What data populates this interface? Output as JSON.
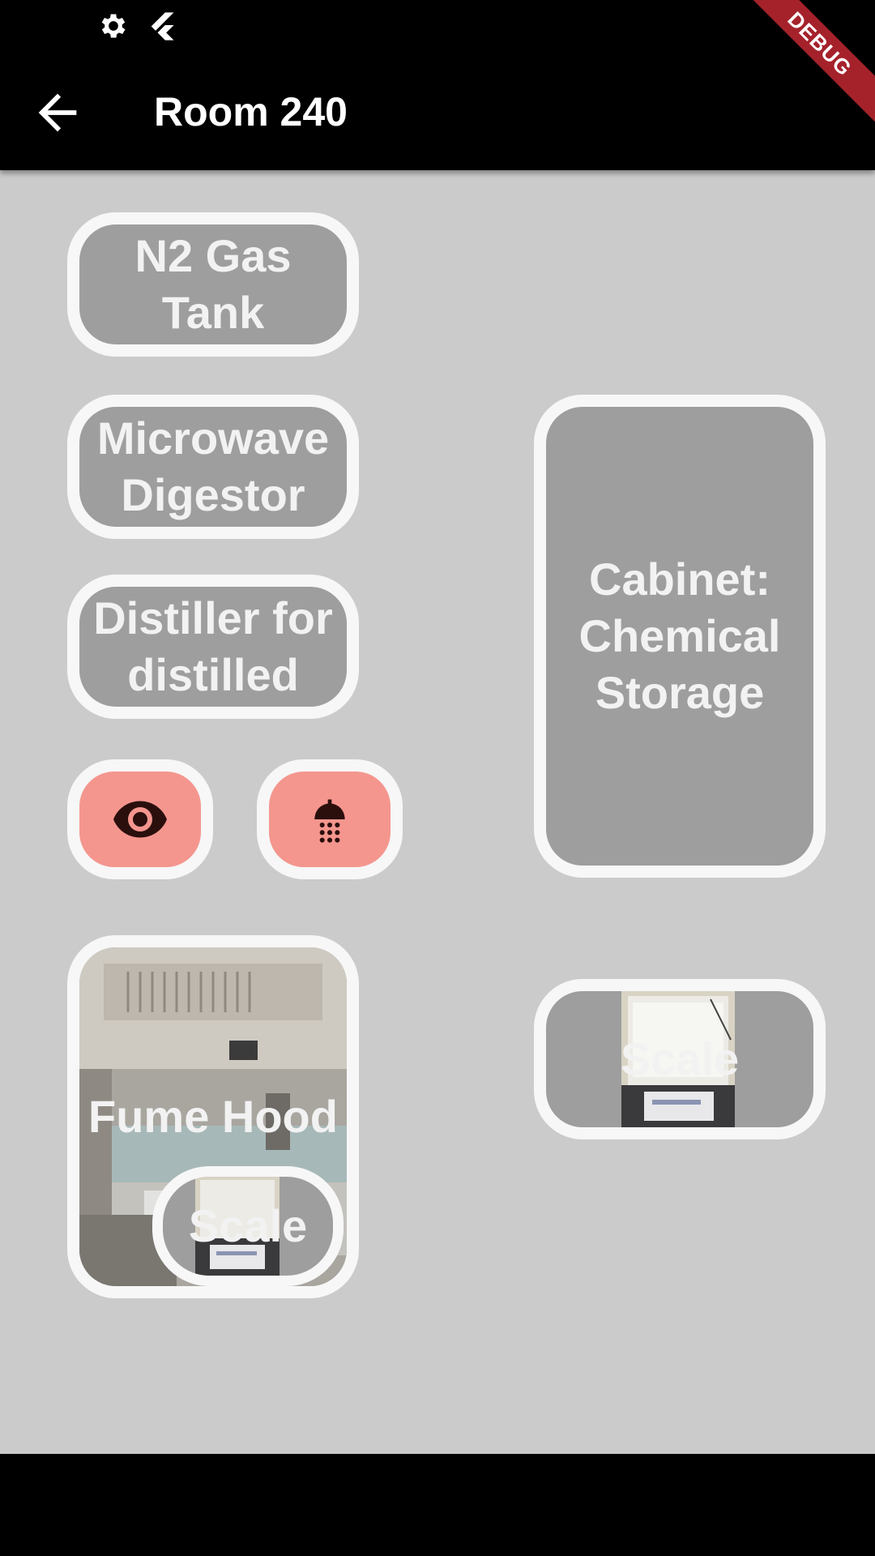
{
  "app": {
    "title": "Room 240",
    "debug_banner": "DEBUG"
  },
  "status_bar": {
    "icons": [
      "settings-gear-icon",
      "flutter-logo-icon"
    ]
  },
  "appbar": {
    "back_icon": "arrow-back-icon"
  },
  "tiles": {
    "n2_gas_tank": {
      "label_line1": "N2 Gas",
      "label_line2": "Tank"
    },
    "microwave_digestor": {
      "label_line1": "Microwave",
      "label_line2": "Digestor"
    },
    "distiller": {
      "label_line1": "Distiller for",
      "label_line2": "distilled"
    },
    "eyewash": {
      "icon": "eye-icon",
      "color": "#f4968e"
    },
    "safety_shower": {
      "icon": "shower-icon",
      "color": "#f4968e"
    },
    "cabinet": {
      "label_line1": "Cabinet:",
      "label_line2": "Chemical",
      "label_line3": "Storage"
    },
    "fume_hood": {
      "label": "Fume Hood"
    },
    "scale_right": {
      "label": "Scale"
    },
    "scale_inset": {
      "label": "Scale"
    }
  },
  "colors": {
    "background": "#cbcbcb",
    "tile_fill": "#9e9e9e",
    "tile_border": "#f7f7f7",
    "safety_fill": "#f4968e",
    "bars": "#000000"
  }
}
